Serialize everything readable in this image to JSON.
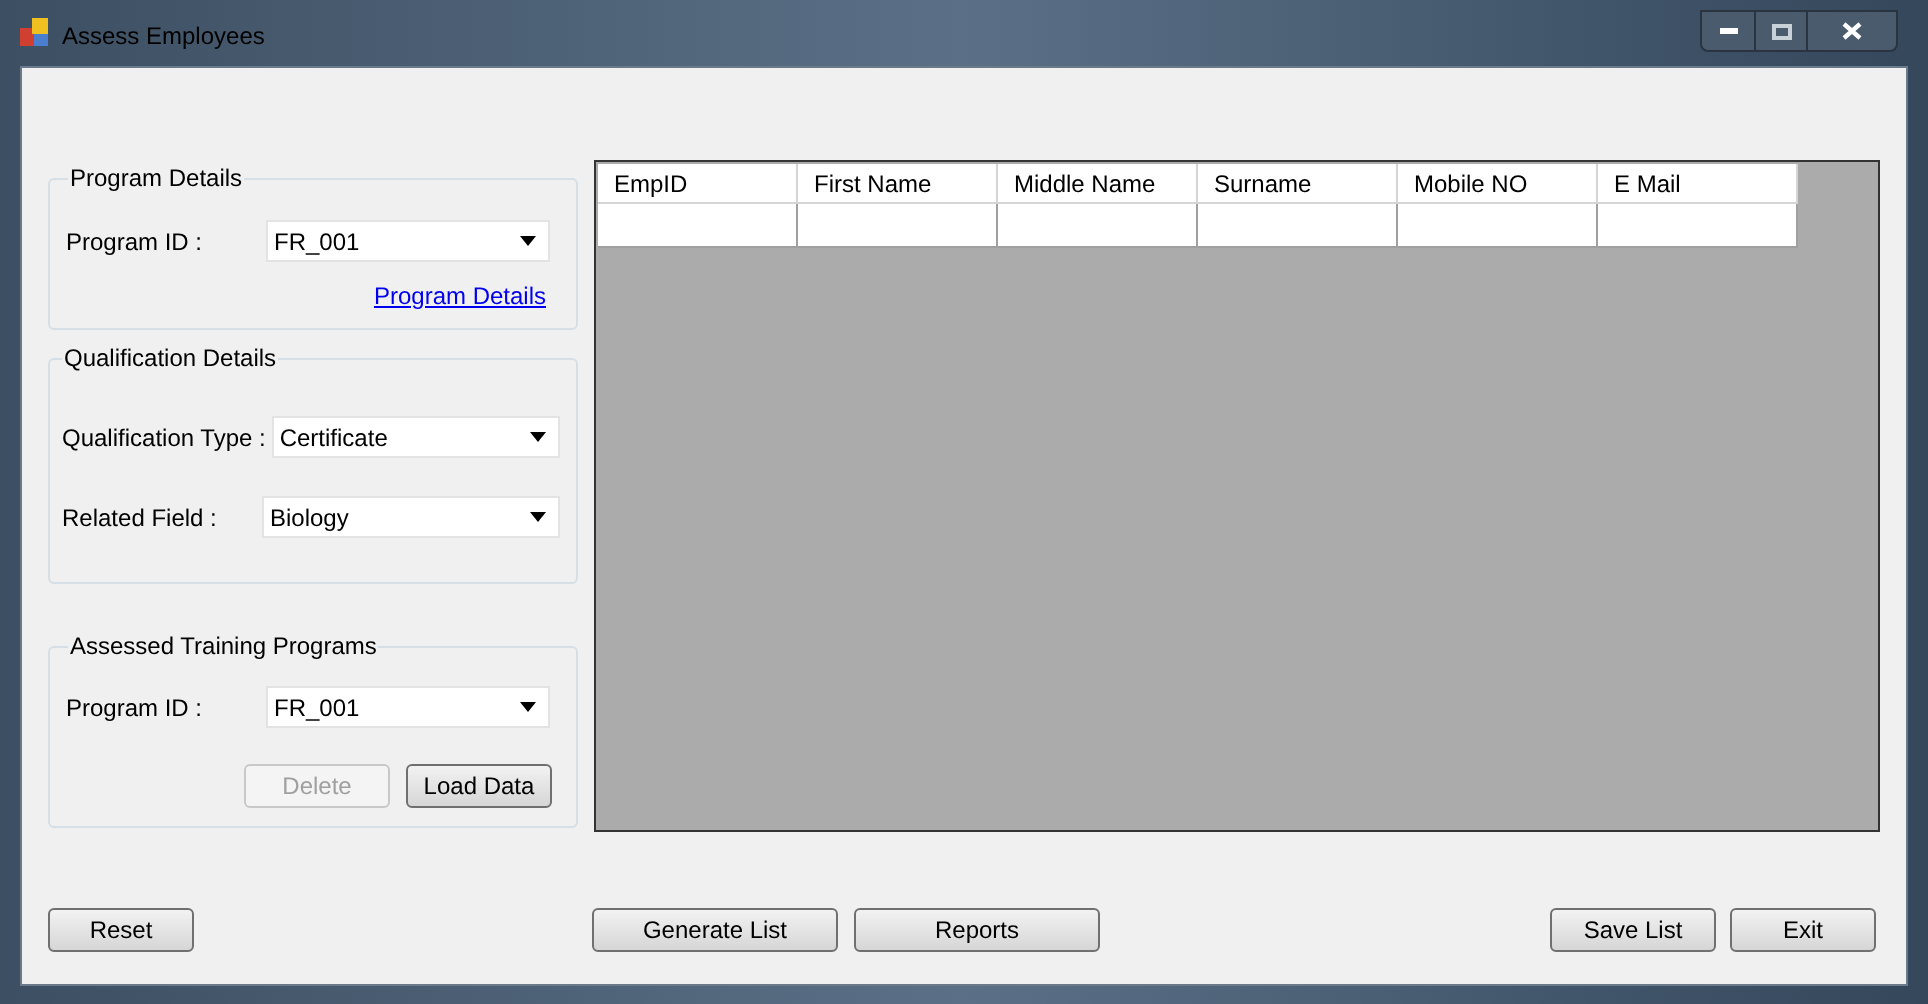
{
  "window": {
    "title": "Assess Employees"
  },
  "program_details": {
    "title": "Program Details",
    "program_id": {
      "label": "Program ID :",
      "value": "FR_001"
    },
    "link": "Program Details"
  },
  "qualification_details": {
    "title": "Qualification Details",
    "fields": [
      {
        "label": "Qualification Type :",
        "value": "Certificate"
      },
      {
        "label": "Related Field :",
        "value": "Biology"
      }
    ]
  },
  "assessed_training_programs": {
    "title": "Assessed Training Programs",
    "program_id": {
      "label": "Program ID :",
      "value": "FR_001"
    },
    "buttons": [
      {
        "label": "Delete",
        "disabled": true
      },
      {
        "label": "Load Data",
        "disabled": false
      }
    ]
  },
  "table": {
    "columns": [
      "EmpID",
      "First Name",
      "Middle Name",
      "Surname",
      "Mobile NO",
      "E Mail"
    ]
  },
  "bottom_buttons": [
    {
      "label": "Reset",
      "disabled": false
    },
    {
      "label": "Generate List",
      "disabled": false
    },
    {
      "label": "Reports",
      "disabled": false
    },
    {
      "label": "Save List",
      "disabled": false
    },
    {
      "label": "Exit",
      "disabled": false
    }
  ]
}
